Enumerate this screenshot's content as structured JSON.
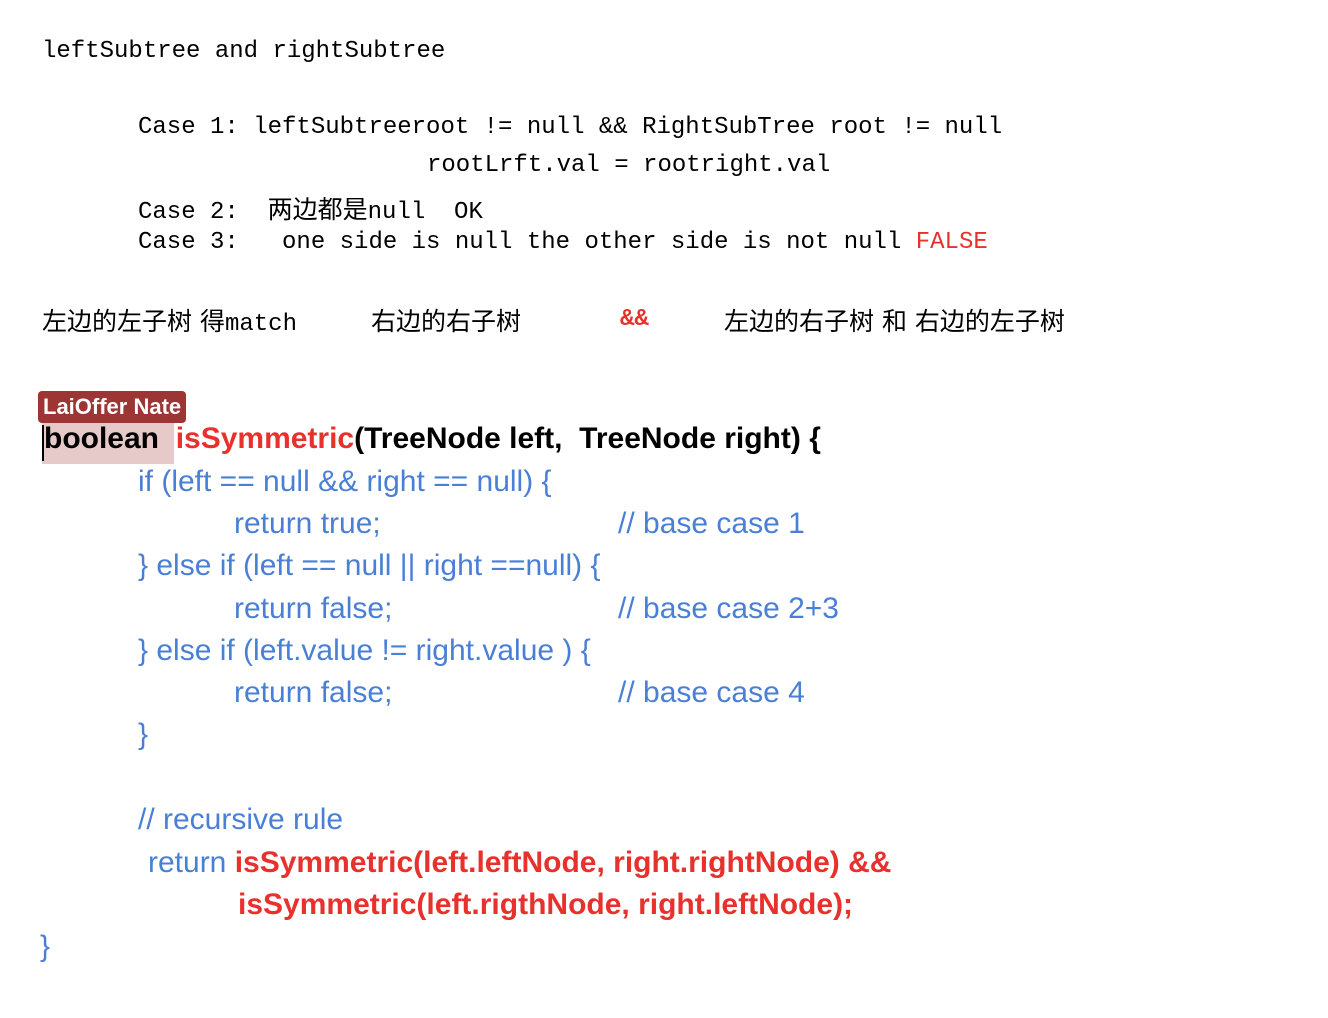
{
  "header": "leftSubtree and rightSubtree",
  "cases": {
    "case1": "Case 1: leftSubtreeroot != null && RightSubTree root != null",
    "case1_cont": "rootLrft.val = rootright.val",
    "case2_prefix": "Case 2:  ",
    "case2_cn": "两边都是",
    "case2_suffix": "null  OK",
    "case3_prefix": "Case 3:   one side is null the other side is not null ",
    "case3_false": "FALSE"
  },
  "chinese_line": {
    "part1": "左边的左子树 得",
    "part1_mono": "match",
    "part2": "右边的右子树",
    "and_sym": "&&",
    "part3": "左边的右子树 和 右边的左子树"
  },
  "comment": {
    "author": "LaiOffer Nate"
  },
  "code": {
    "sig_boolean": "boolean",
    "sig_fn": "isSymmetric",
    "sig_rest": "(TreeNode left,  TreeNode right) {",
    "l1": "if (left == null && right == null) {",
    "l2_code": "return true;",
    "l2_comment": "// base case 1",
    "l3": "} else if (left == null || right ==null) {",
    "l4_code": "return false;",
    "l4_comment": "// base case 2+3",
    "l5": "} else if (left.value != right.value ) {",
    "l6_code": "return false;",
    "l6_comment": "// base case 4",
    "l7": "}",
    "l8": "// recursive rule",
    "l9_return": "return ",
    "l9_call": "isSymmetric(left.leftNode, right.rightNode) &&",
    "l10_call": "isSymmetric(left.rigthNode, right.leftNode);",
    "close": "}"
  },
  "colors": {
    "accent_red": "#e8312d",
    "code_blue": "#4a7fd6",
    "comment_tag_bg": "#9e3535",
    "highlight": "#e6c9c9"
  }
}
